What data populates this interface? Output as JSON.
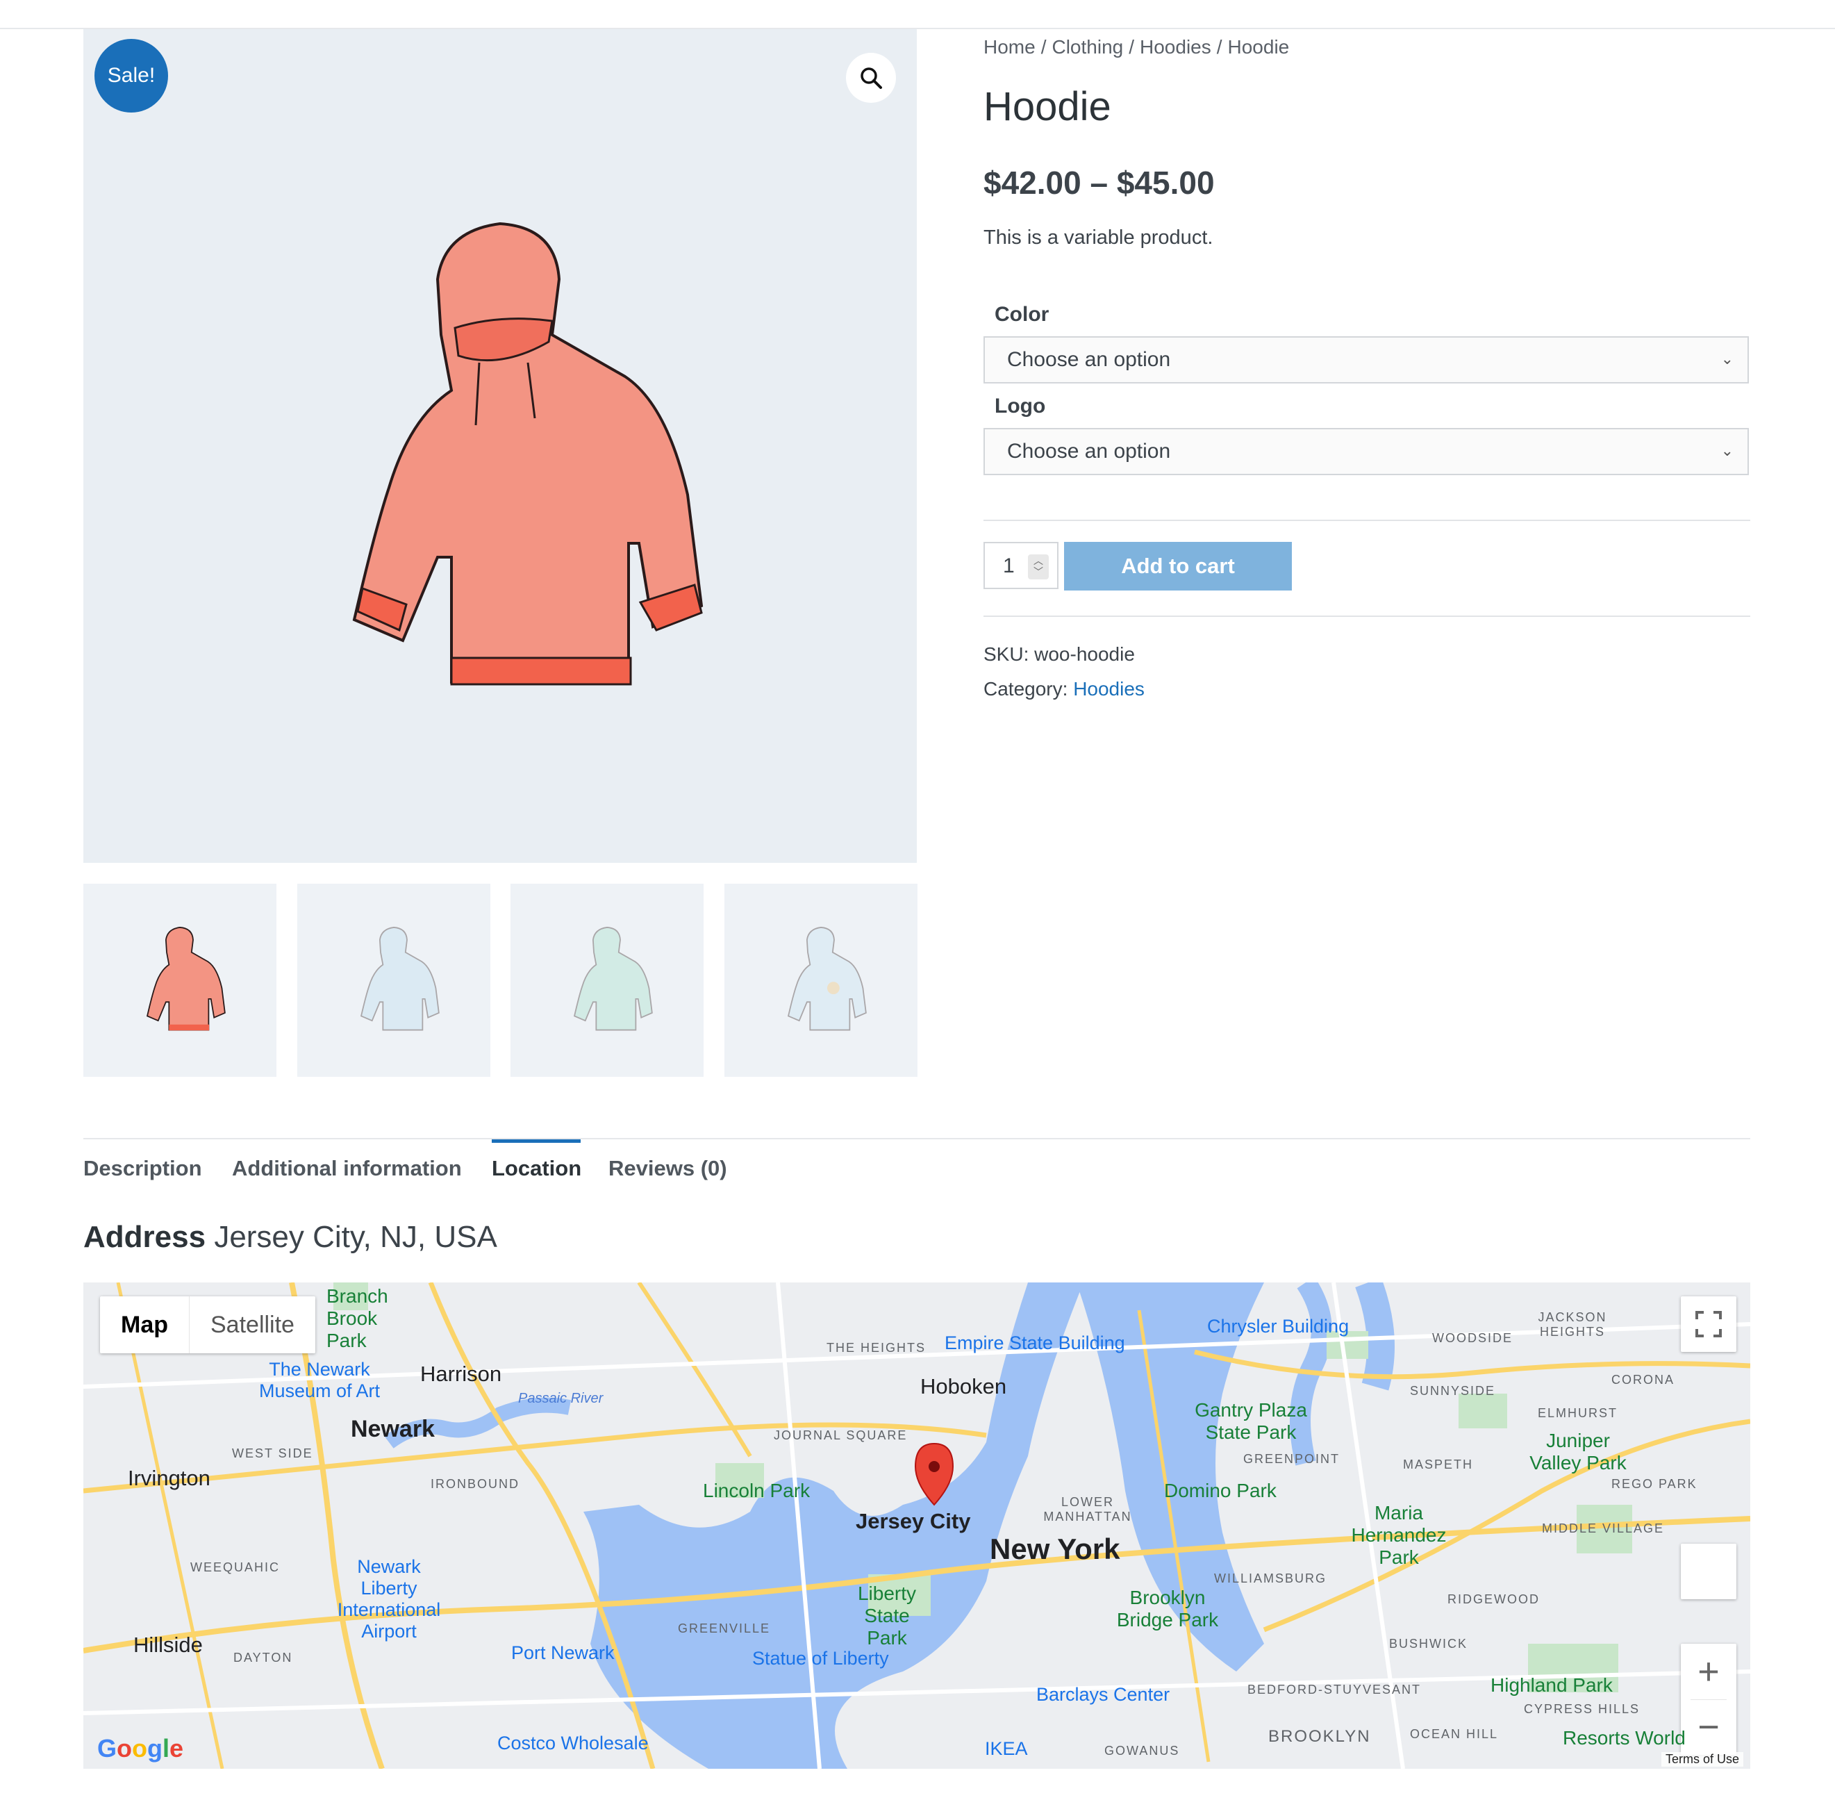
{
  "breadcrumb": {
    "items": [
      "Home",
      "Clothing",
      "Hoodies",
      "Hoodie"
    ],
    "separator": "/"
  },
  "product": {
    "title": "Hoodie",
    "price": "$42.00 – $45.00",
    "short_description": "This is a variable product.",
    "sale_badge": "Sale!",
    "sku_label": "SKU:",
    "sku": "woo-hoodie",
    "category_label": "Category:",
    "category": "Hoodies"
  },
  "variations": {
    "color_label": "Color",
    "color_placeholder": "Choose an option",
    "logo_label": "Logo",
    "logo_placeholder": "Choose an option"
  },
  "cart": {
    "quantity": "1",
    "add_to_cart_label": "Add to cart"
  },
  "tabs": [
    {
      "label": "Description"
    },
    {
      "label": "Additional information"
    },
    {
      "label": "Location"
    },
    {
      "label": "Reviews (0)"
    }
  ],
  "location": {
    "address_label": "Address",
    "address_value": "Jersey City, NJ, USA"
  },
  "map": {
    "type_map": "Map",
    "type_satellite": "Satellite",
    "labels": {
      "jersey_city": "Jersey City",
      "new_york": "New York",
      "newark": "Newark",
      "hoboken": "Hoboken",
      "harrison": "Harrison",
      "irvington": "Irvington",
      "hillside": "Hillside",
      "empire_state": "Empire State Building",
      "chrysler": "Chrysler Building",
      "newark_museum": "The Newark Museum of Art",
      "newark_airport": "Newark Liberty International Airport",
      "port_newark": "Port Newark",
      "statue_liberty": "Statue of Liberty",
      "liberty_park": "Liberty State Park",
      "lincoln_park": "Lincoln Park",
      "gantry_park": "Gantry Plaza State Park",
      "domino_park": "Domino Park",
      "brooklyn_bridge_park": "Brooklyn Bridge Park",
      "barclays": "Barclays Center",
      "maria_park": "Maria Hernandez Park",
      "juniper_park": "Juniper Valley Park",
      "highland_park": "Highland Park",
      "costco": "Costco Wholesale",
      "ikea": "IKEA",
      "branch_brook": "Branch Brook Park",
      "the_heights": "THE HEIGHTS",
      "journal_square": "JOURNAL SQUARE",
      "west_side": "WEST SIDE",
      "greenville": "GREENVILLE",
      "lower_manhattan": "LOWER MANHATTAN",
      "greenpoint": "GREENPOINT",
      "williamsburg": "WILLIAMSBURG",
      "woodside": "WOODSIDE",
      "sunnyside": "SUNNYSIDE",
      "maspeth": "MASPETH",
      "ridgewood": "RIDGEWOOD",
      "bushwick": "BUSHWICK",
      "bedford": "BEDFORD-STUYVESANT",
      "brooklyn": "BROOKLYN",
      "corona": "CORONA",
      "elmhurst": "ELMHURST",
      "rego_park": "REGO PARK",
      "middle_village": "MIDDLE VILLAGE",
      "ironbound": "IRONBOUND",
      "weequahic": "WEEQUAHIC",
      "dayton": "DAYTON",
      "passaic_river": "Passaic River",
      "ocean_hill": "OCEAN HILL",
      "gowanus": "GOWANUS",
      "jackson_heights": "JACKSON HEIGHTS",
      "cypress_hills": "CYPRESS HILLS",
      "resorts_world": "Resorts World"
    },
    "terms": "Terms of Use",
    "google": "Google"
  },
  "colors": {
    "accent": "#1a6fb9",
    "button": "#7fb3dd",
    "hoodie": "#f08a78"
  }
}
